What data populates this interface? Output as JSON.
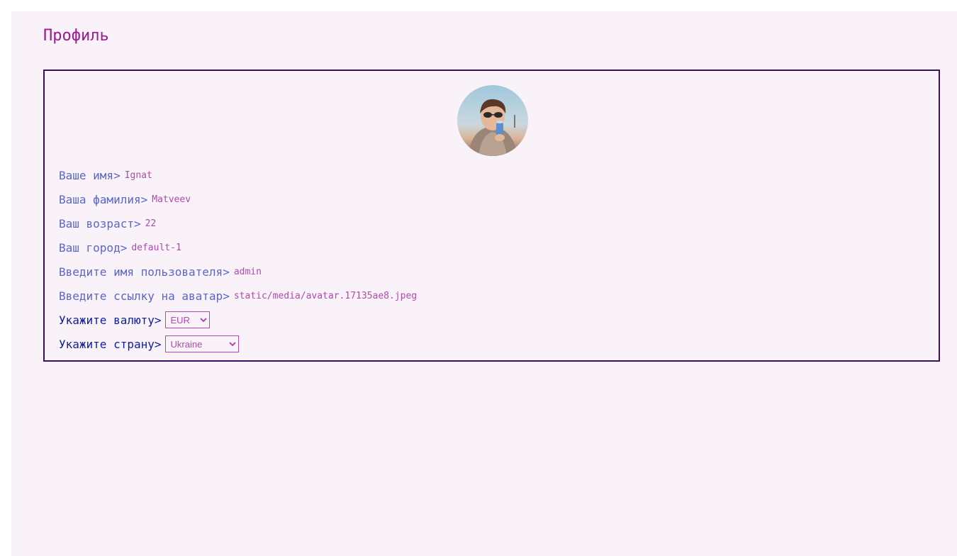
{
  "page": {
    "title": "Профиль"
  },
  "profile": {
    "avatar_alt": "avatar",
    "fields": [
      {
        "label": "Ваше имя>",
        "value": "Ignat"
      },
      {
        "label": "Ваша фамилия>",
        "value": "Matveev"
      },
      {
        "label": "Ваш возраст>",
        "value": "22"
      },
      {
        "label": "Ваш город>",
        "value": "default-1"
      },
      {
        "label": "Введите имя пользователя>",
        "value": "admin"
      },
      {
        "label": "Введите ссылку на аватар>",
        "value": "static/media/avatar.17135ae8.jpeg"
      }
    ],
    "currency": {
      "label": "Укажите валюту>",
      "selected": "EUR"
    },
    "country": {
      "label": "Укажите страну>",
      "selected": "Ukraine"
    }
  },
  "colors": {
    "title": "#9b1a8f",
    "border": "#3a0f63",
    "label": "#5a67c7",
    "label_select": "#0f1f9a",
    "value": "#b04ab0",
    "background": "#f9f2f9"
  }
}
